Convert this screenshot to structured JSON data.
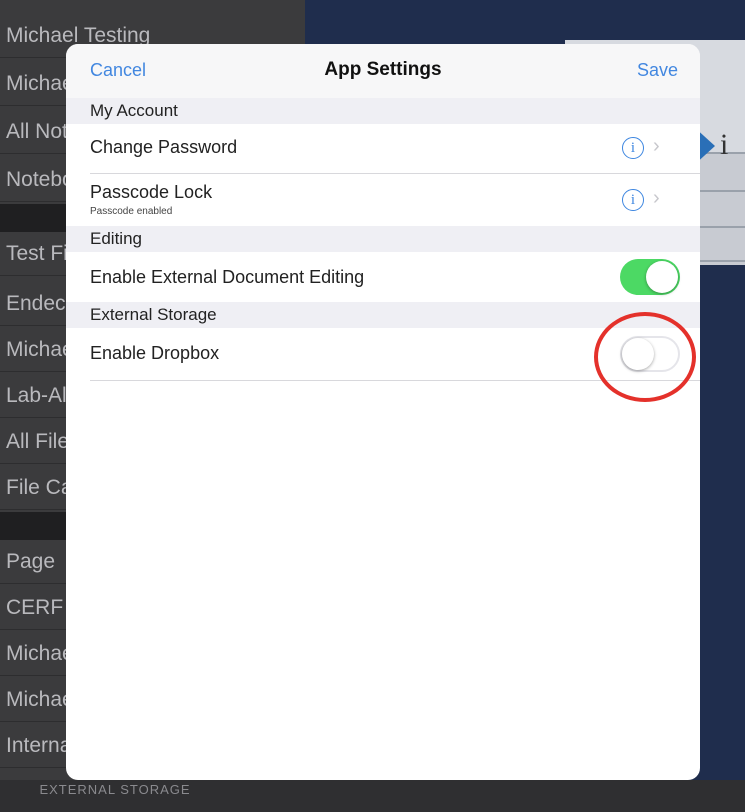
{
  "background": {
    "sidebar_rows": [
      {
        "label": "Michael Testing"
      },
      {
        "label": "Michael"
      },
      {
        "label": "All Notes"
      },
      {
        "label": "Notebooks"
      },
      {
        "label": "Test Fi"
      },
      {
        "label": "Endeck"
      },
      {
        "label": "Michael"
      },
      {
        "label": "Lab-Al"
      },
      {
        "label": "All File"
      },
      {
        "label": "File Ca"
      },
      {
        "label": "Page"
      },
      {
        "label": "CERF n"
      },
      {
        "label": "Michael"
      },
      {
        "label": "Michael"
      },
      {
        "label": "Interna"
      }
    ],
    "external_storage_header": "EXTERNAL STORAGE",
    "doc_glyph": "i"
  },
  "modal": {
    "title": "App Settings",
    "cancel_label": "Cancel",
    "save_label": "Save",
    "sections": {
      "my_account": {
        "header": "My Account",
        "change_password": "Change Password",
        "passcode_lock": "Passcode Lock",
        "passcode_status": "Passcode enabled"
      },
      "editing": {
        "header": "Editing",
        "external_editing": "Enable External Document Editing",
        "external_editing_on": true
      },
      "external_storage": {
        "header": "External Storage",
        "dropbox": "Enable Dropbox",
        "dropbox_on": false
      }
    },
    "info_glyph": "i",
    "chevron_glyph": "›"
  },
  "colors": {
    "accent": "#4287e0",
    "toggle_on": "#4cd964",
    "highlight": "#e4312b"
  }
}
